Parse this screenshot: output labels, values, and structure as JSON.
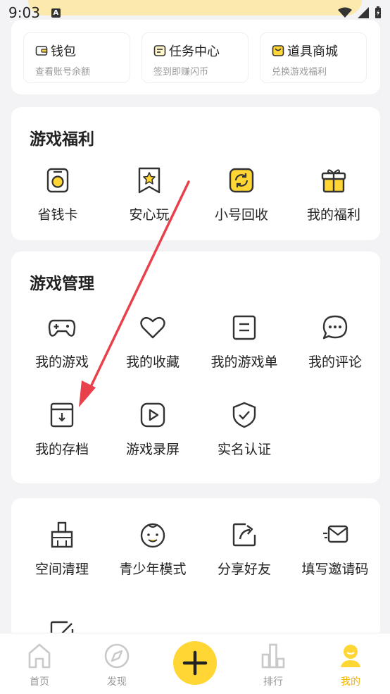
{
  "status_bar": {
    "time": "9:03",
    "notif_letter": "A"
  },
  "top_cards": [
    {
      "title": "钱包",
      "subtitle": "查看账号余额",
      "icon": "wallet-icon"
    },
    {
      "title": "任务中心",
      "subtitle": "签到即赚闪币",
      "icon": "task-icon"
    },
    {
      "title": "道具商城",
      "subtitle": "兑换游戏福利",
      "icon": "shop-icon"
    }
  ],
  "welfare": {
    "title": "游戏福利",
    "items": [
      {
        "label": "省钱卡",
        "icon": "savings-card-icon"
      },
      {
        "label": "安心玩",
        "icon": "safe-play-icon"
      },
      {
        "label": "小号回收",
        "icon": "recycle-icon"
      },
      {
        "label": "我的福利",
        "icon": "gift-icon"
      }
    ]
  },
  "management": {
    "title": "游戏管理",
    "items": [
      {
        "label": "我的游戏",
        "icon": "gamepad-icon"
      },
      {
        "label": "我的收藏",
        "icon": "heart-icon"
      },
      {
        "label": "我的游戏单",
        "icon": "game-list-icon"
      },
      {
        "label": "我的评论",
        "icon": "comment-icon"
      },
      {
        "label": "我的存档",
        "icon": "archive-icon"
      },
      {
        "label": "游戏录屏",
        "icon": "play-record-icon"
      },
      {
        "label": "实名认证",
        "icon": "shield-check-icon"
      }
    ]
  },
  "tools": {
    "items": [
      {
        "label": "空间清理",
        "icon": "broom-icon"
      },
      {
        "label": "青少年模式",
        "icon": "child-face-icon"
      },
      {
        "label": "分享好友",
        "icon": "share-icon"
      },
      {
        "label": "填写邀请码",
        "icon": "mail-icon"
      }
    ]
  },
  "bottom_nav": [
    {
      "label": "首页",
      "icon": "home-icon"
    },
    {
      "label": "发现",
      "icon": "compass-icon"
    },
    {
      "label": "",
      "icon": "plus-icon"
    },
    {
      "label": "排行",
      "icon": "ranking-icon"
    },
    {
      "label": "我的",
      "icon": "profile-icon"
    }
  ],
  "colors": {
    "accent": "#ffd633",
    "accent_text": "#f2b400",
    "annotation_arrow": "#e8414b"
  }
}
